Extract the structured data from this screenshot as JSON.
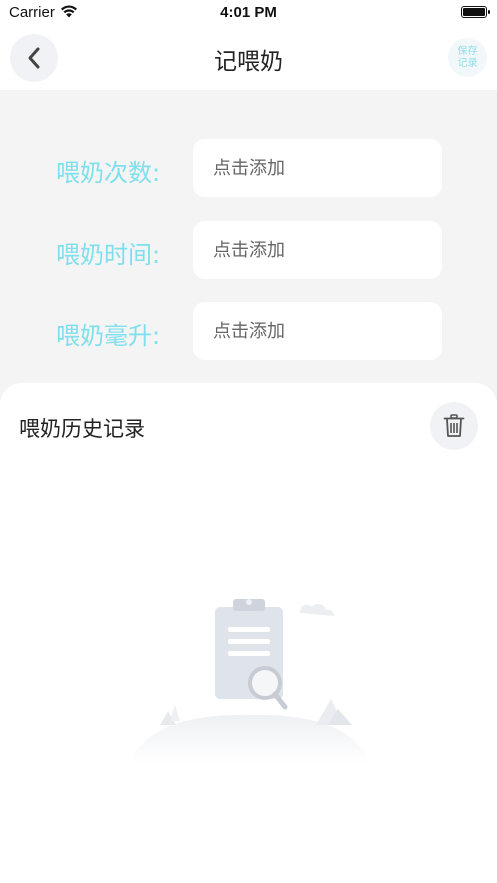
{
  "status_bar": {
    "carrier": "Carrier",
    "time": "4:01 PM"
  },
  "nav": {
    "title": "记喂奶",
    "save_line1": "保存",
    "save_line2": "记录"
  },
  "form": {
    "fields": [
      {
        "label": "喂奶次数:",
        "placeholder": "点击添加",
        "value": ""
      },
      {
        "label": "喂奶时间:",
        "placeholder": "点击添加",
        "value": ""
      },
      {
        "label": "喂奶毫升:",
        "placeholder": "点击添加",
        "value": ""
      }
    ]
  },
  "history": {
    "title": "喂奶历史记录"
  },
  "colors": {
    "accent": "#7ee0ec",
    "form_bg": "#f4f4f4",
    "button_bg": "#f1f2f5"
  },
  "icons": {
    "back": "chevron-left-icon",
    "trash": "trash-icon",
    "empty": "empty-clipboard-icon"
  }
}
